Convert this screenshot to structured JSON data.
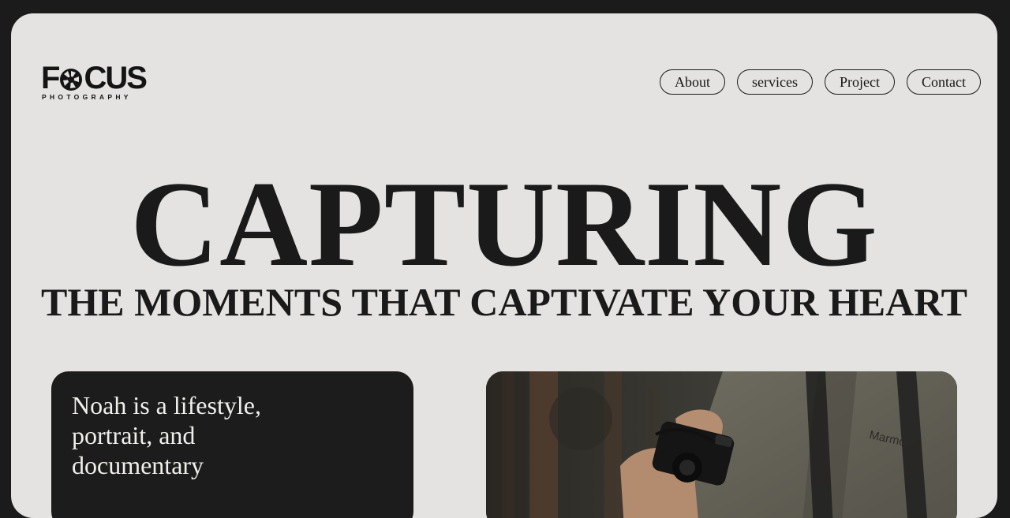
{
  "logo": {
    "word_start": "F",
    "word_end": "CUS",
    "tagline": "PHOTOGRAPHY"
  },
  "nav": {
    "items": [
      "About",
      "services",
      "Project",
      "Contact"
    ]
  },
  "hero": {
    "title": "CAPTURING",
    "subtitle": "THE MOMENTS THAT CAPTIVATE YOUR HEART"
  },
  "bio": {
    "text": "Noah is a lifestyle, portrait, and documentary"
  },
  "photo": {
    "strap_text": "Marmot"
  },
  "colors": {
    "frame": "#1b1b1b",
    "page_bg": "#e4e3e1",
    "ink": "#1a1a1a",
    "card_dark": "#1c1c1c",
    "card_text": "#f0efec"
  },
  "icons": {
    "logo_mark": "camera-aperture-icon"
  }
}
